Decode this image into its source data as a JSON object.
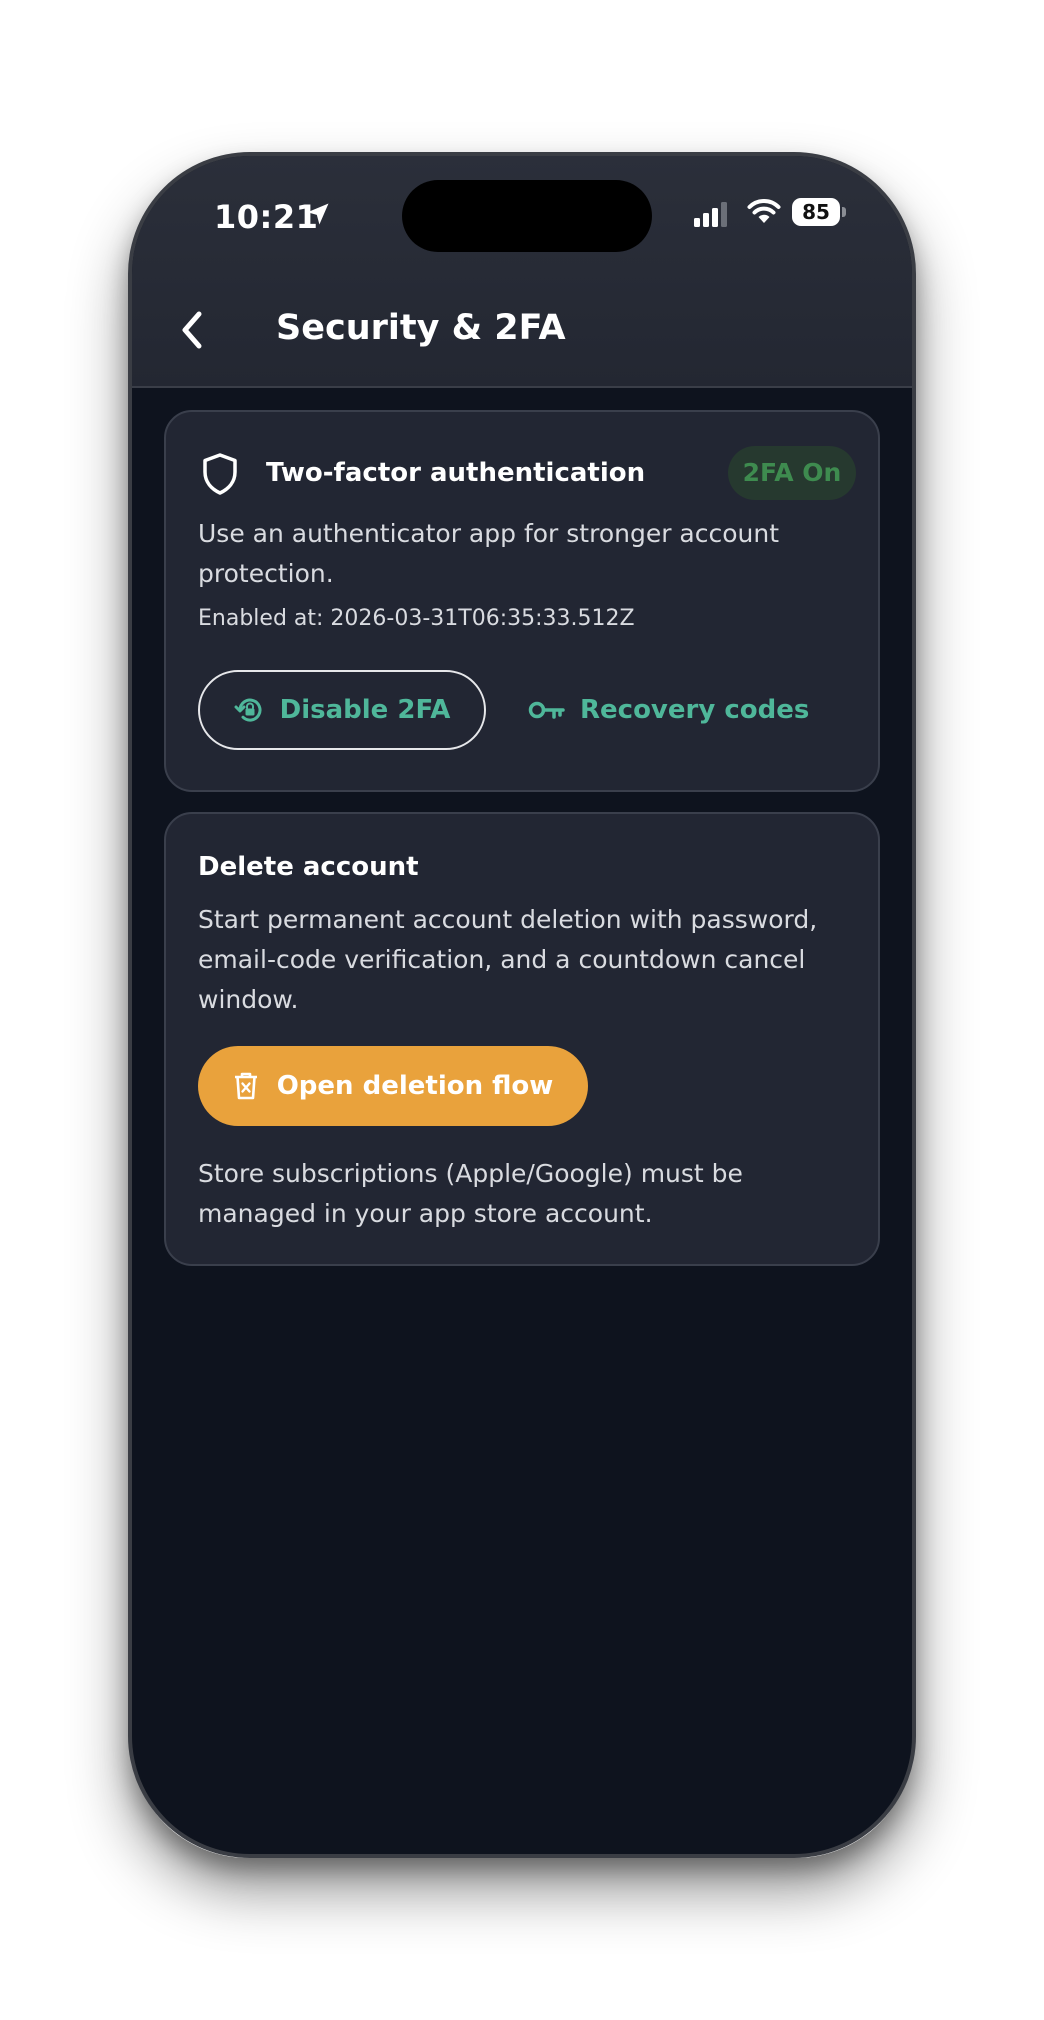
{
  "status_bar": {
    "time": "10:21",
    "battery": "85"
  },
  "header": {
    "title": "Security & 2FA"
  },
  "two_factor": {
    "title": "Two-factor authentication",
    "badge": "2FA On",
    "description": "Use an authenticator app for stronger account protection.",
    "enabled_at": "Enabled at: 2026-03-31T06:35:33.512Z",
    "disable_label": "Disable 2FA",
    "recovery_label": "Recovery codes"
  },
  "delete_account": {
    "title": "Delete account",
    "description": "Start permanent account deletion with password, email-code verification, and a countdown cancel window.",
    "button_label": "Open deletion flow",
    "note": "Store subscriptions (Apple/Google) must be managed in your app store account."
  },
  "colors": {
    "accent_teal": "#4fb79a",
    "badge_green": "#3e8b4f",
    "delete_orange": "#e9a23c",
    "background": "#0e131e",
    "card": "#222633"
  }
}
